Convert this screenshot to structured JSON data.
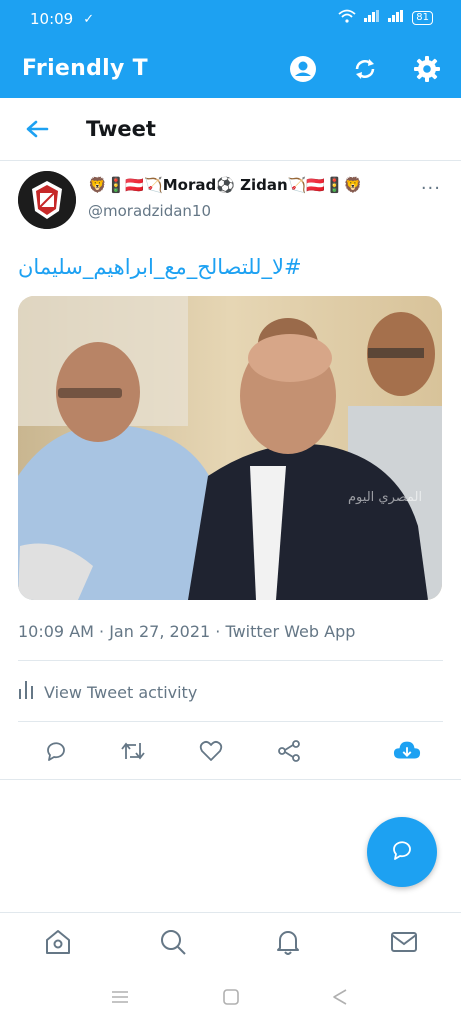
{
  "status_bar": {
    "time": "10:09",
    "battery": "81"
  },
  "app_bar": {
    "title": "Friendly T"
  },
  "header": {
    "title": "Tweet"
  },
  "tweet": {
    "display_name": "🦁🚦🇦🇹🏹Morad⚽ Zidan🏹🇦🇹🚦🦁",
    "handle": "@moradzidan10",
    "more": "···",
    "text": "#لا_للتصالح_مع_ابراهيم_سليمان",
    "meta": "10:09 AM · Jan 27, 2021 · Twitter Web App",
    "activity_label": "View Tweet activity",
    "watermark": "المصري اليوم"
  },
  "colors": {
    "brand": "#1da1f2",
    "muted": "#657786",
    "divider": "#e1e8ed"
  },
  "icons": {
    "app_bar": [
      "account-icon",
      "refresh-icon",
      "settings-icon"
    ],
    "actions": [
      "reply-icon",
      "retweet-icon",
      "like-icon",
      "share-icon",
      "download-icon"
    ],
    "bottom_nav": [
      "home-icon",
      "search-icon",
      "notifications-icon",
      "messages-icon"
    ],
    "system_nav": [
      "menu-icon",
      "home-square-icon",
      "back-triangle-icon"
    ]
  }
}
